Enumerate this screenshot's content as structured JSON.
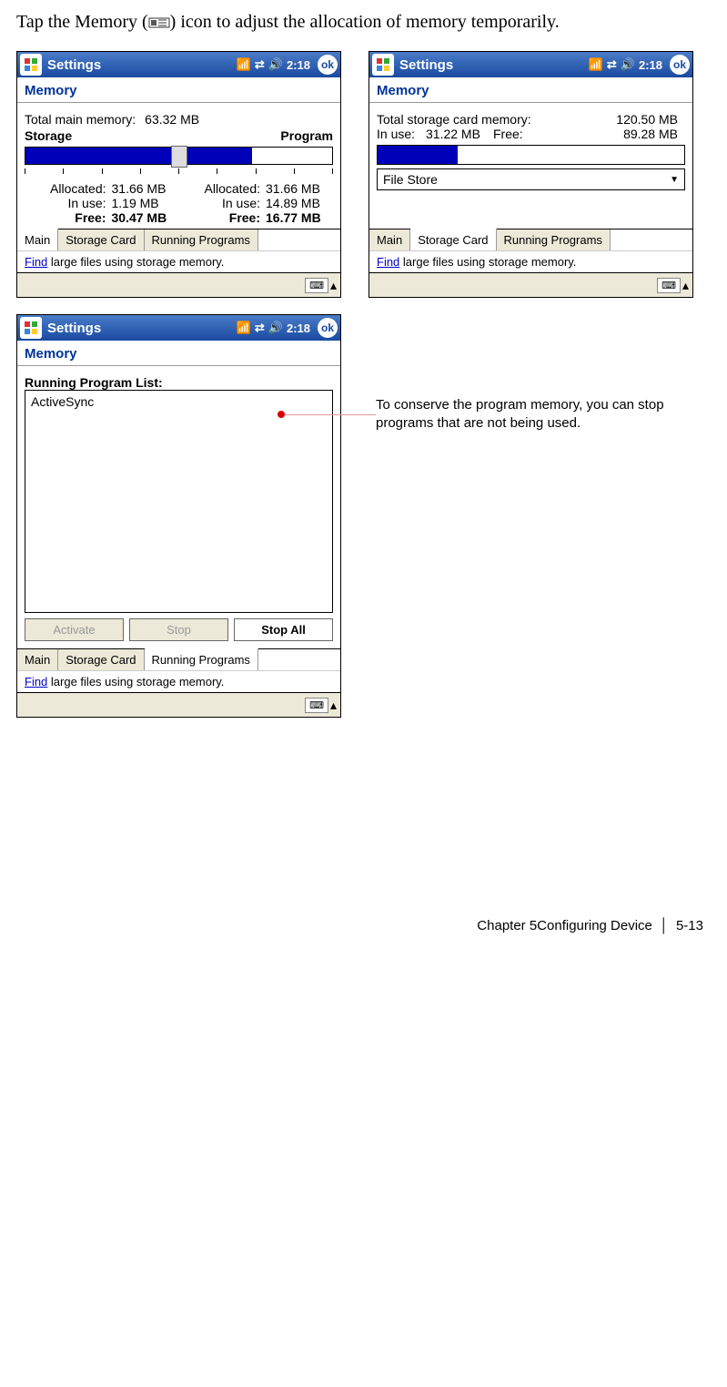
{
  "intro": {
    "pre": "Tap the Memory (",
    "post": ") icon to adjust the allocation of memory temporarily."
  },
  "titlebar": {
    "title": "Settings",
    "time": "2:18",
    "ok": "ok"
  },
  "screen1": {
    "heading": "Memory",
    "total_label": "Total main memory:",
    "total_value": "63.32 MB",
    "storage": "Storage",
    "program": "Program",
    "s_alloc_l": "Allocated:",
    "s_alloc_v": "31.66 MB",
    "s_use_l": "In use:",
    "s_use_v": "1.19 MB",
    "s_free_l": "Free:",
    "s_free_v": "30.47 MB",
    "p_alloc_l": "Allocated:",
    "p_alloc_v": "31.66 MB",
    "p_use_l": "In use:",
    "p_use_v": "14.89 MB",
    "p_free_l": "Free:",
    "p_free_v": "16.77 MB"
  },
  "screen2": {
    "heading": "Memory",
    "total_label": "Total storage card memory:",
    "total_value": "120.50 MB",
    "inuse_l": "In use:",
    "inuse_v": "31.22 MB",
    "free_l": "Free:",
    "free_v": "89.28 MB",
    "dropdown": "File Store"
  },
  "screen3": {
    "heading": "Memory",
    "list_label": "Running Program List:",
    "item1": "ActiveSync",
    "btn_activate": "Activate",
    "btn_stop": "Stop",
    "btn_stopall": "Stop All"
  },
  "tabs": {
    "main": "Main",
    "storage": "Storage Card",
    "running": "Running Programs"
  },
  "find": {
    "link": "Find",
    "rest": " large files using storage memory."
  },
  "callout": "To conserve the program memory, you can stop programs that are not being used.",
  "footer": {
    "chapter": "Chapter 5Configuring Device",
    "sep": "│",
    "page": "5-13"
  }
}
